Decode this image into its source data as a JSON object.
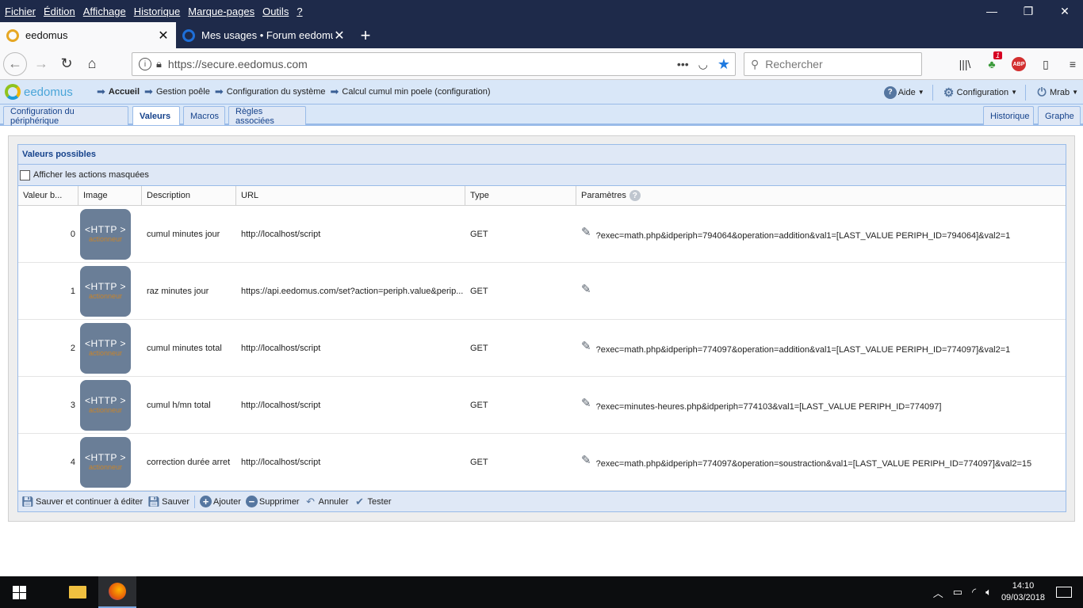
{
  "menubar": [
    "Fichier",
    "Édition",
    "Affichage",
    "Historique",
    "Marque-pages",
    "Outils",
    "?"
  ],
  "window_controls": {
    "minimize": "—",
    "restore": "❐",
    "close": "✕"
  },
  "tabs": [
    {
      "label": "eedomus",
      "close": "✕",
      "active": true
    },
    {
      "label": "Mes usages • Forum eedomus",
      "close": "✕",
      "active": false
    }
  ],
  "newtab": "+",
  "nav": {
    "url": "https://secure.eedomus.com",
    "search_placeholder": "Rechercher",
    "more": "•••",
    "addon_badge": "1",
    "abp": "ABP"
  },
  "app": {
    "logo": "eedomus",
    "breadcrumbs": [
      "Accueil",
      "Gestion poêle",
      "Configuration du système",
      "Calcul cumul min poele (configuration)"
    ],
    "menu": {
      "help": "Aide",
      "config": "Configuration",
      "user": "Mrab"
    }
  },
  "page_tabs": {
    "left": [
      "Configuration du périphérique",
      "Valeurs",
      "Macros",
      "Règles associées"
    ],
    "right": [
      "Historique",
      "Graphe"
    ]
  },
  "panel": {
    "title": "Valeurs possibles",
    "show_hidden_label": "Afficher les actions masquées",
    "columns": [
      "Valeur b...",
      "Image",
      "Description",
      "URL",
      "Type",
      "Paramètres"
    ],
    "help_glyph": "?",
    "icon_text": {
      "top": "<HTTP >",
      "bottom": "actionneur"
    },
    "rows": [
      {
        "value": "0",
        "description": "cumul minutes jour",
        "url": "http://localhost/script",
        "type": "GET",
        "params": "?exec=math.php&idperiph=794064&operation=addition&val1=[LAST_VALUE PERIPH_ID=794064]&val2=1"
      },
      {
        "value": "1",
        "description": "raz minutes jour",
        "url": "https://api.eedomus.com/set?action=periph.value&perip...",
        "type": "GET",
        "params": ""
      },
      {
        "value": "2",
        "description": "cumul minutes total",
        "url": "http://localhost/script",
        "type": "GET",
        "params": "?exec=math.php&idperiph=774097&operation=addition&val1=[LAST_VALUE PERIPH_ID=774097]&val2=1"
      },
      {
        "value": "3",
        "description": "cumul h/mn total",
        "url": "http://localhost/script",
        "type": "GET",
        "params": "?exec=minutes-heures.php&idperiph=774103&val1=[LAST_VALUE PERIPH_ID=774097]"
      },
      {
        "value": "4",
        "description": "correction durée arret",
        "url": "http://localhost/script",
        "type": "GET",
        "params": "?exec=math.php&idperiph=774097&operation=soustraction&val1=[LAST_VALUE PERIPH_ID=774097]&val2=15"
      }
    ],
    "footer": [
      "Sauver et continuer à éditer",
      "Sauver",
      "Ajouter",
      "Supprimer",
      "Annuler",
      "Tester"
    ]
  },
  "taskbar": {
    "time": "14:10",
    "date": "09/03/2018"
  }
}
